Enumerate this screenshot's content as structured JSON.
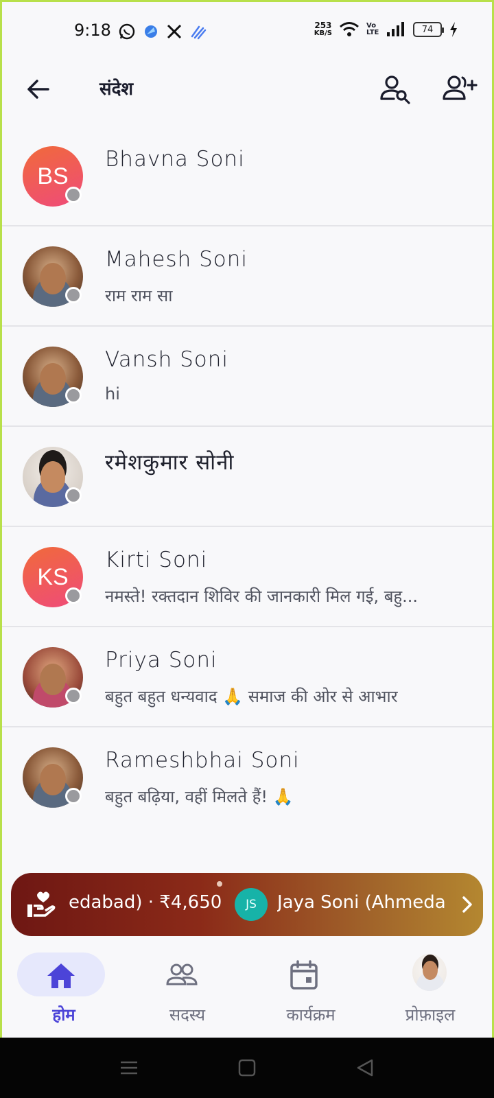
{
  "status_bar": {
    "time": "9:18",
    "left_icons": [
      "whatsapp-icon",
      "app-icon",
      "x-icon",
      "signal-app-icon"
    ],
    "net_speed_value": "253",
    "net_speed_unit": "KB/S",
    "volte": "Vo LTE",
    "battery": "74"
  },
  "header": {
    "title": "संदेश",
    "icons": [
      "back-arrow-icon",
      "search-user-icon",
      "add-user-icon"
    ]
  },
  "chats": [
    {
      "name": "Bhavna Soni",
      "preview": "",
      "avatar_initials": "BS",
      "avatar_type": "initials"
    },
    {
      "name": "Mahesh Soni",
      "preview": "राम राम सा",
      "avatar_initials": "",
      "avatar_type": "photo"
    },
    {
      "name": "Vansh Soni",
      "preview": "hi",
      "avatar_initials": "",
      "avatar_type": "photo"
    },
    {
      "name": "रमेशकुमार सोनी",
      "preview": "",
      "avatar_initials": "",
      "avatar_type": "photo"
    },
    {
      "name": "Kirti Soni",
      "preview": "नमस्ते! रक्तदान शिविर की जानकारी मिल गई, बहु...",
      "avatar_initials": "KS",
      "avatar_type": "initials"
    },
    {
      "name": "Priya Soni",
      "preview": "बहुत बहुत धन्यवाद 🙏 समाज की ओर से आभार",
      "avatar_initials": "",
      "avatar_type": "photo"
    },
    {
      "name": "Rameshbhai Soni",
      "preview": "बहुत बढ़िया, वहीं मिलते हैं! 🙏",
      "avatar_initials": "",
      "avatar_type": "photo"
    }
  ],
  "banner": {
    "text_1": "edabad) · ₹4,650",
    "badge": "JS",
    "text_2": "Jaya Soni (Ahmedal",
    "icon": "donation-hand-heart-icon"
  },
  "bottom_nav": [
    {
      "label": "होम",
      "icon": "home-icon",
      "active": true
    },
    {
      "label": "सदस्य",
      "icon": "members-icon",
      "active": false
    },
    {
      "label": "कार्यक्रम",
      "icon": "calendar-icon",
      "active": false
    },
    {
      "label": "प्रोफ़ाइल",
      "icon": "profile-avatar",
      "active": false
    }
  ],
  "colors": {
    "accent": "#4c44d8",
    "presence_offline": "#9a9a9e",
    "banner_start": "#6e1713",
    "banner_end": "#b48730"
  }
}
